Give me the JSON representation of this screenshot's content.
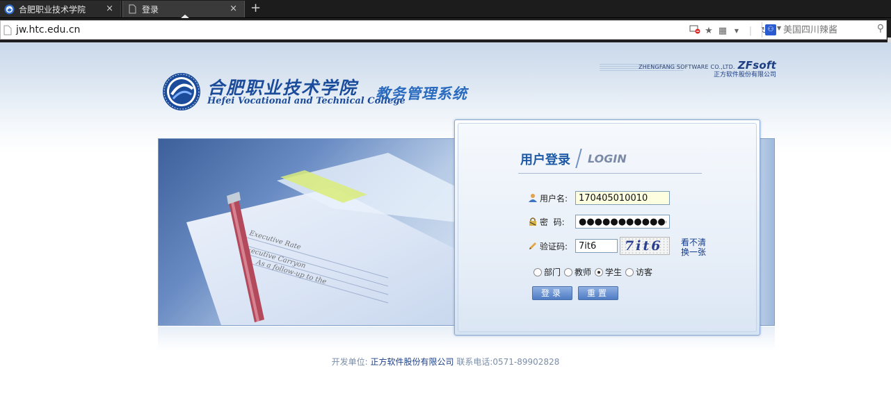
{
  "browser": {
    "tabs": [
      {
        "label": "合肥职业技术学院",
        "active": false,
        "close": "×"
      },
      {
        "label": "登录",
        "active": true,
        "close": "×"
      }
    ],
    "new_tab": "+",
    "url": "jw.htc.edu.cn",
    "search_placeholder": "美国四川辣酱"
  },
  "header": {
    "school_cn": "合肥职业技术学院",
    "school_en": "Hefei Vocational and Technical College",
    "system_name": "教务管理系统",
    "vendor_en": "ZHENGFANG SOFTWARE CO.,LTD.",
    "vendor_brand": "ZFsoft",
    "vendor_cn": "正方软件股份有限公司"
  },
  "login": {
    "title": "用户登录",
    "title_en": "LOGIN",
    "username_label": "用户名:",
    "username_value": "170405010010",
    "password_label": "密  码:",
    "password_value": "●●●●●●●●●●●●●●●●●",
    "captcha_label": "验证码:",
    "captcha_value": "7it6",
    "captcha_image_text": "7it6",
    "refresh_line1": "看不清",
    "refresh_line2": "换一张",
    "roles": [
      {
        "label": "部门",
        "selected": false
      },
      {
        "label": "教师",
        "selected": false
      },
      {
        "label": "学生",
        "selected": true
      },
      {
        "label": "访客",
        "selected": false
      }
    ],
    "login_button": "登录",
    "reset_button": "重置"
  },
  "footer": {
    "dev_label": "开发单位:",
    "dev_company": "正方软件股份有限公司",
    "phone": "联系电话:0571-89902828"
  },
  "colors": {
    "primary": "#1f5aa7",
    "button": "#4f7cc4",
    "chrome_dark": "#1c1c1c"
  }
}
